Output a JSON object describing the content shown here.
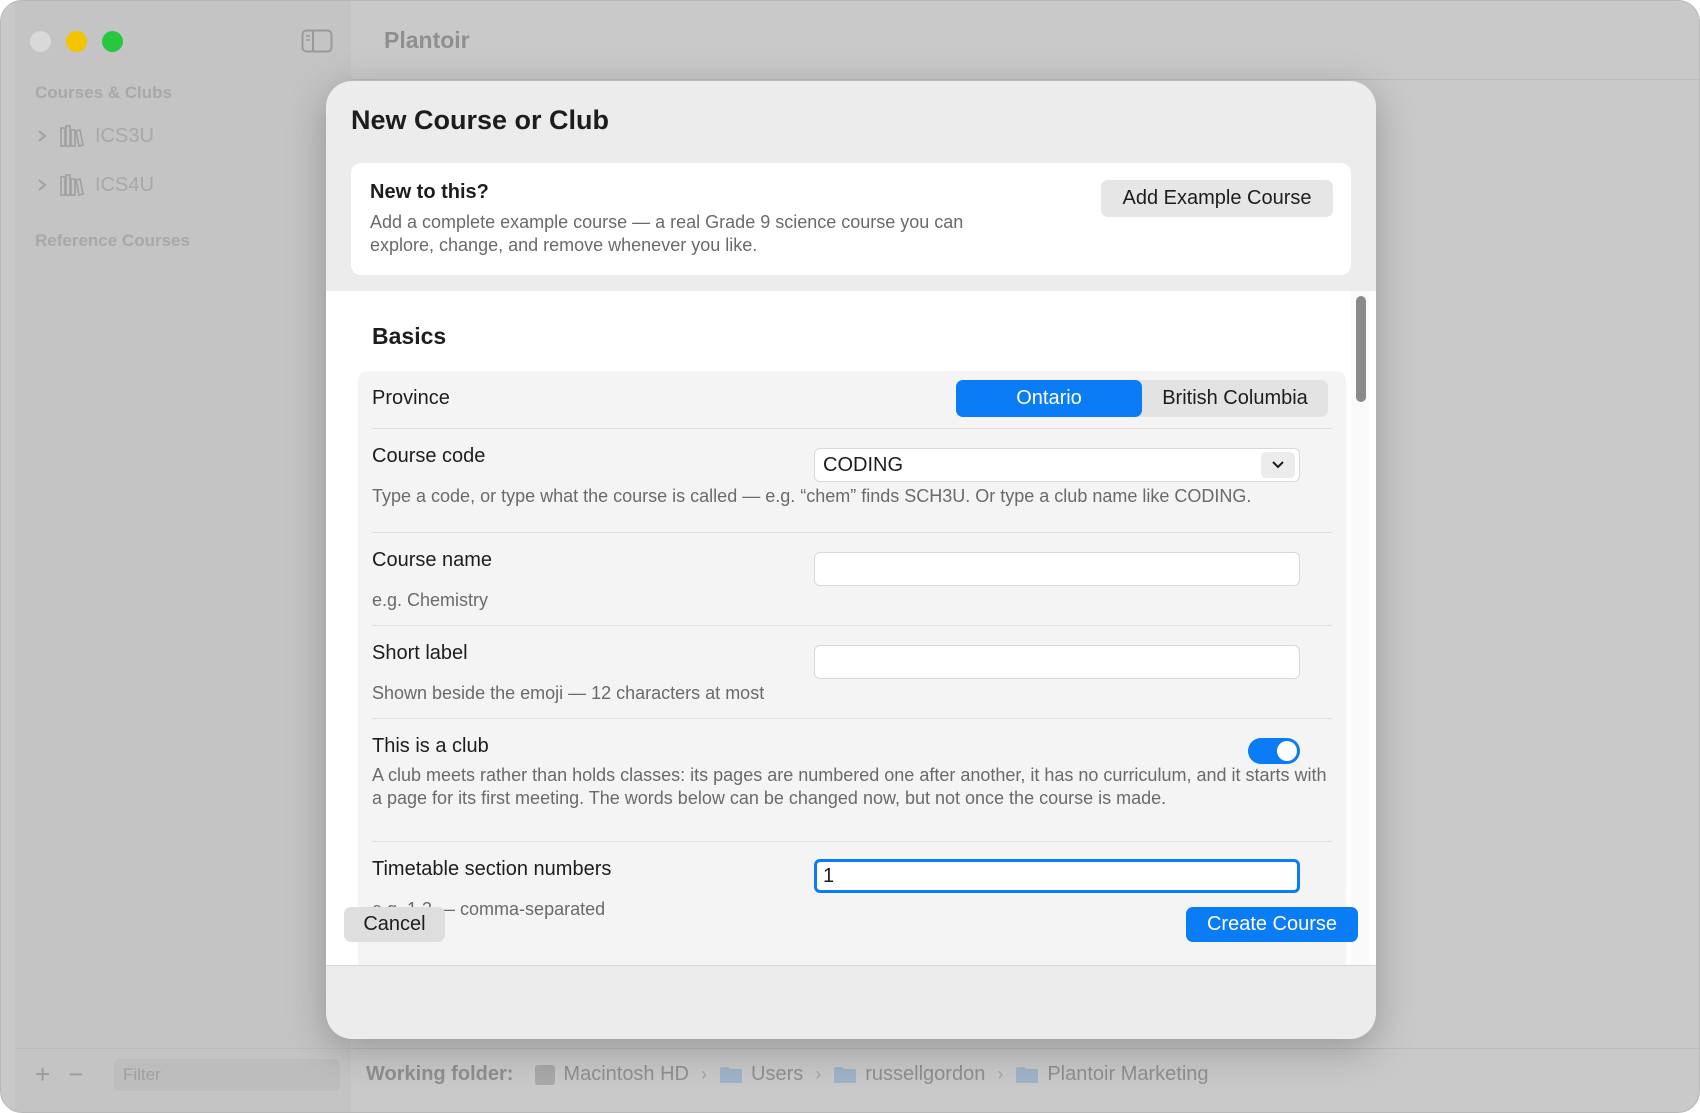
{
  "app": {
    "title": "Plantoir"
  },
  "sidebar": {
    "sections": [
      {
        "title": "Courses & Clubs"
      },
      {
        "title": "Reference Courses"
      }
    ],
    "items": [
      {
        "label": "ICS3U",
        "icon": "books-icon"
      },
      {
        "label": "ICS4U",
        "icon": "books-icon"
      }
    ],
    "filter_placeholder": "Filter"
  },
  "working_folder": {
    "label": "Working folder:",
    "path": [
      "Macintosh HD",
      "Users",
      "russellgordon",
      "Plantoir Marketing"
    ]
  },
  "sheet": {
    "title": "New Course or Club",
    "intro": {
      "heading": "New to this?",
      "text": "Add a complete example course — a real Grade 9 science course you can explore, change, and remove whenever you like.",
      "button": "Add Example Course"
    },
    "basics_title": "Basics",
    "province": {
      "label": "Province",
      "options": [
        "Ontario",
        "British Columbia"
      ],
      "selected": "Ontario"
    },
    "course_code": {
      "label": "Course code",
      "value": "CODING",
      "hint": "Type a code, or type what the course is called — e.g. “chem” finds SCH3U. Or type a club name like CODING."
    },
    "course_name": {
      "label": "Course name",
      "value": "",
      "hint": "e.g. Chemistry"
    },
    "short_label": {
      "label": "Short label",
      "value": "",
      "hint": "Shown beside the emoji — 12 characters at most"
    },
    "is_club": {
      "label": "This is a club",
      "on": true,
      "hint": "A club meets rather than holds classes: its pages are numbered one after another, it has no curriculum, and it starts with a page for its first meeting. The words below can be changed now, but not once the course is made."
    },
    "timetable": {
      "label": "Timetable section numbers",
      "value": "1",
      "hint": "e.g. 1,3 — comma-separated"
    },
    "cancel_label": "Cancel",
    "create_label": "Create Course"
  },
  "colors": {
    "accent": "#0a7cf5"
  }
}
